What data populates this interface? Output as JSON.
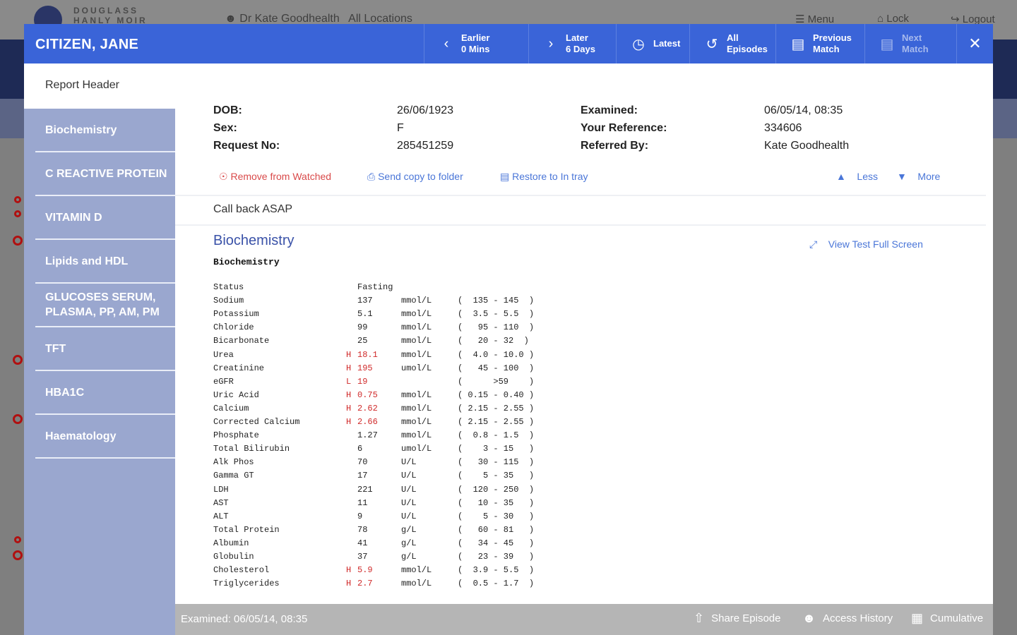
{
  "background": {
    "brand": "DOUGLASS HANLY MOIR",
    "user": "Dr Kate Goodhealth",
    "location": "All Locations",
    "menu_label": "Menu",
    "lock_label": "Lock",
    "logout_label": "Logout"
  },
  "header": {
    "patient_name": "CITIZEN, JANE",
    "earlier": {
      "line1": "Earlier",
      "line2": "0 Mins"
    },
    "later": {
      "line1": "Later",
      "line2": "6 Days"
    },
    "latest": "Latest",
    "all_episodes": {
      "line1": "All",
      "line2": "Episodes"
    },
    "previous_match": {
      "line1": "Previous",
      "line2": "Match"
    },
    "next_match": {
      "line1": "Next",
      "line2": "Match"
    },
    "accent_color": "#3a64d8"
  },
  "sidebar": {
    "header": "Report Header",
    "items": [
      {
        "label": "Biochemistry"
      },
      {
        "label": "C REACTIVE PROTEIN"
      },
      {
        "label": "VITAMIN D"
      },
      {
        "label": "Lipids and HDL"
      },
      {
        "label": "GLUCOSES SERUM, PLASMA, PP, AM, PM"
      },
      {
        "label": "TFT"
      },
      {
        "label": "HBA1C"
      },
      {
        "label": "Haematology"
      }
    ]
  },
  "patient_info": {
    "dob_label": "DOB:",
    "dob": "26/06/1923",
    "sex_label": "Sex:",
    "sex": "F",
    "request_label": "Request No:",
    "request_no": "285451259",
    "examined_label": "Examined:",
    "examined": "06/05/14, 08:35",
    "reference_label": "Your Reference:",
    "reference": "334606",
    "referred_label": "Referred By:",
    "referred_by": "Kate Goodhealth"
  },
  "actions": {
    "remove_watched": "Remove from Watched",
    "send_copy": "Send copy to folder",
    "restore_tray": "Restore to In tray",
    "less": "Less",
    "more": "More"
  },
  "note": "Call back ASAP",
  "report": {
    "title": "Biochemistry",
    "subtitle": "Biochemistry",
    "view_full_screen": "View Test Full Screen",
    "rows": [
      {
        "name": "Status",
        "flag": "",
        "value": "Fasting",
        "unit": "",
        "range": ""
      },
      {
        "name": "Sodium",
        "flag": "",
        "value": "137",
        "unit": "mmol/L",
        "range": "(  135 - 145  )"
      },
      {
        "name": "Potassium",
        "flag": "",
        "value": "5.1",
        "unit": "mmol/L",
        "range": "(  3.5 - 5.5  )"
      },
      {
        "name": "Chloride",
        "flag": "",
        "value": "99",
        "unit": "mmol/L",
        "range": "(   95 - 110  )"
      },
      {
        "name": "Bicarbonate",
        "flag": "",
        "value": "25",
        "unit": "mmol/L",
        "range": "(   20 - 32  )"
      },
      {
        "name": "Urea",
        "flag": "H",
        "value": "18.1",
        "unit": "mmol/L",
        "range": "(  4.0 - 10.0 )"
      },
      {
        "name": "Creatinine",
        "flag": "H",
        "value": "195",
        "unit": "umol/L",
        "range": "(   45 - 100  )"
      },
      {
        "name": "eGFR",
        "flag": "L",
        "value": "19",
        "unit": "",
        "range": "(      >59    )"
      },
      {
        "name": "Uric Acid",
        "flag": "H",
        "value": "0.75",
        "unit": "mmol/L",
        "range": "( 0.15 - 0.40 )"
      },
      {
        "name": "Calcium",
        "flag": "H",
        "value": "2.62",
        "unit": "mmol/L",
        "range": "( 2.15 - 2.55 )"
      },
      {
        "name": "Corrected Calcium",
        "flag": "H",
        "value": "2.66",
        "unit": "mmol/L",
        "range": "( 2.15 - 2.55 )"
      },
      {
        "name": "Phosphate",
        "flag": "",
        "value": "1.27",
        "unit": "mmol/L",
        "range": "(  0.8 - 1.5  )"
      },
      {
        "name": "Total Bilirubin",
        "flag": "",
        "value": "6",
        "unit": "umol/L",
        "range": "(    3 - 15   )"
      },
      {
        "name": "Alk Phos",
        "flag": "",
        "value": "70",
        "unit": "U/L",
        "range": "(   30 - 115  )"
      },
      {
        "name": "Gamma GT",
        "flag": "",
        "value": "17",
        "unit": "U/L",
        "range": "(    5 - 35   )"
      },
      {
        "name": "LDH",
        "flag": "",
        "value": "221",
        "unit": "U/L",
        "range": "(  120 - 250  )"
      },
      {
        "name": "AST",
        "flag": "",
        "value": "11",
        "unit": "U/L",
        "range": "(   10 - 35   )"
      },
      {
        "name": "ALT",
        "flag": "",
        "value": "9",
        "unit": "U/L",
        "range": "(    5 - 30   )"
      },
      {
        "name": "Total Protein",
        "flag": "",
        "value": "78",
        "unit": "g/L",
        "range": "(   60 - 81   )"
      },
      {
        "name": "Albumin",
        "flag": "",
        "value": "41",
        "unit": "g/L",
        "range": "(   34 - 45   )"
      },
      {
        "name": "Globulin",
        "flag": "",
        "value": "37",
        "unit": "g/L",
        "range": "(   23 - 39   )"
      },
      {
        "name": "Cholesterol",
        "flag": "H",
        "value": "5.9",
        "unit": "mmol/L",
        "range": "(  3.9 - 5.5  )"
      },
      {
        "name": "Triglycerides",
        "flag": "H",
        "value": "2.7",
        "unit": "mmol/L",
        "range": "(  0.5 - 1.7  )"
      }
    ]
  },
  "footer": {
    "examined": "Examined: 06/05/14, 08:35",
    "share_episode": "Share Episode",
    "access_history": "Access History",
    "cumulative": "Cumulative"
  }
}
